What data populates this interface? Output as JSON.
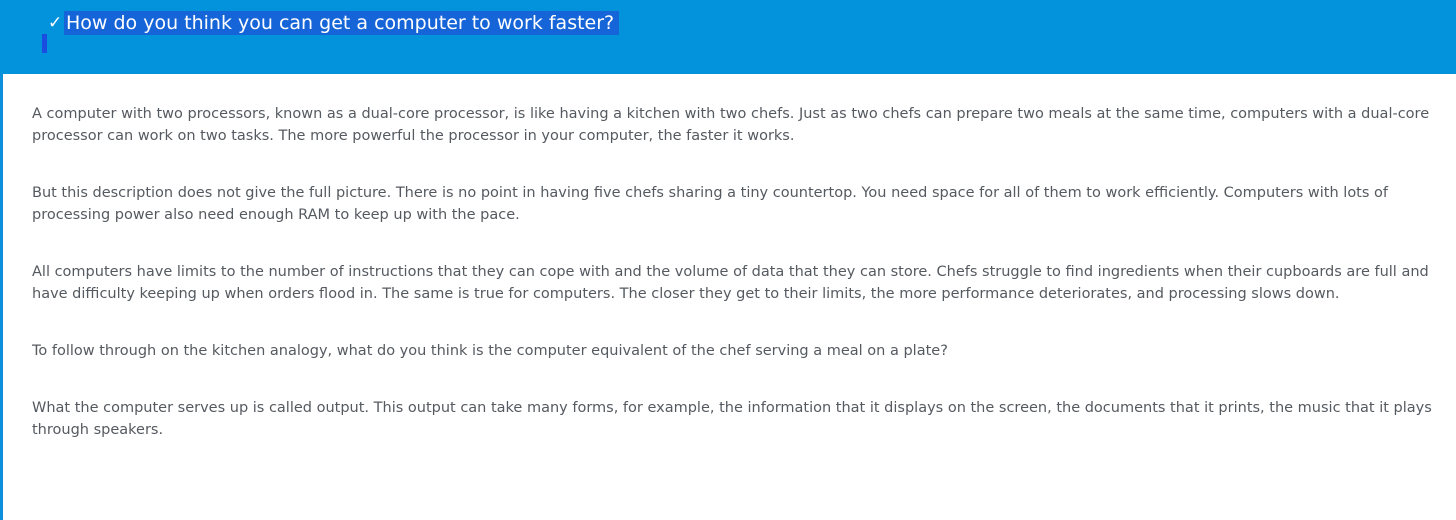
{
  "header": {
    "check_icon": "✓",
    "question": "How do you think you can get a computer to work faster?"
  },
  "content": {
    "paragraphs": [
      "A computer with two processors, known as a dual-core processor, is like having a kitchen with two chefs. Just as two chefs can prepare two meals at the same time, computers with a dual-core processor can work on two tasks. The more powerful the processor in your computer, the faster it works.",
      "But this description does not give the full picture. There is no point in having five chefs sharing a tiny countertop. You need space for all of them to work efficiently. Computers with lots of processing power also need enough RAM to keep up with the pace.",
      "All computers have limits to the number of instructions that they can cope with and the volume of data that they can store. Chefs struggle to find ingredients when their cupboards are full and have difficulty keeping up when orders flood in. The same is true for computers. The closer they get to their limits, the more performance deteriorates, and processing slows down.",
      "To follow through on the kitchen analogy, what do you think is the computer equivalent of the chef serving a meal on a plate?",
      "What the computer serves up is called output. This output can take many forms, for example, the information that it displays on the screen, the documents that it prints, the music that it plays through speakers."
    ]
  },
  "colors": {
    "header_bg": "#0392dc",
    "selection": "#1565d8",
    "body_text": "#555a60",
    "left_border": "#0e8fdb"
  }
}
